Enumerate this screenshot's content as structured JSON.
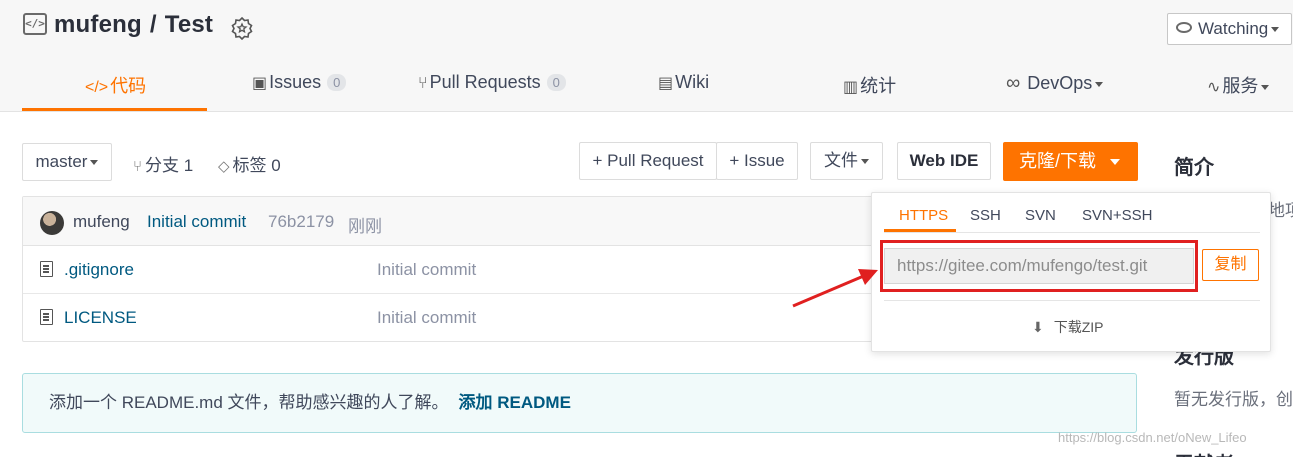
{
  "repo": {
    "owner": "mufeng",
    "separator": "/",
    "name": "Test"
  },
  "watch": {
    "label": "Watching"
  },
  "tabs": [
    {
      "icon": "</>",
      "label": "代码"
    },
    {
      "icon": "▣",
      "label": "Issues",
      "count": "0"
    },
    {
      "icon": "⑂",
      "label": "Pull Requests",
      "count": "0"
    },
    {
      "icon": "▤",
      "label": "Wiki"
    },
    {
      "icon": "▥",
      "label": "统计"
    },
    {
      "icon": "∞",
      "label": "DevOps"
    },
    {
      "icon": "∿",
      "label": "服务"
    }
  ],
  "toolbar": {
    "branch": "master",
    "branches": "分支 1",
    "tags": "标签 0",
    "pull_request": "+ Pull Request",
    "issue": "+ Issue",
    "file": "文件",
    "web_ide": "Web IDE",
    "clone": "克隆/下载"
  },
  "commit": {
    "author": "mufeng",
    "message": "Initial commit",
    "hash": "76b2179",
    "time": "刚刚"
  },
  "files": [
    {
      "name": ".gitignore",
      "message": "Initial commit"
    },
    {
      "name": "LICENSE",
      "message": "Initial commit"
    }
  ],
  "readme": {
    "text": "添加一个 README.md 文件，帮助感兴趣的人了解。",
    "link": "添加 README"
  },
  "sidebar": {
    "intro_title": "简介",
    "intro_partial": "地项",
    "release_title": "发行版",
    "release_text": "暂无发行版，创",
    "contrib_title": "贡献者"
  },
  "clone_dropdown": {
    "protocols": [
      "HTTPS",
      "SSH",
      "SVN",
      "SVN+SSH"
    ],
    "active": "HTTPS",
    "url": "https://gitee.com/mufengo/test.git",
    "copy": "复制",
    "download_zip": "下载ZIP"
  },
  "watermark": "https://blog.csdn.net/oNew_Lifeo",
  "colors": {
    "accent": "#fe7300",
    "link": "#005980",
    "annotation": "#e02020"
  }
}
